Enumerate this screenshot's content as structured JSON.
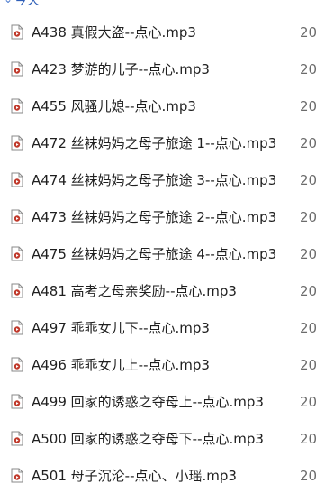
{
  "group_header": {
    "label": "今天"
  },
  "files": [
    {
      "name": "A438 真假大盗--点心.mp3",
      "date": "20",
      "icon": "audio-file-icon"
    },
    {
      "name": "A423 梦游的儿子--点心.mp3",
      "date": "20",
      "icon": "audio-file-icon"
    },
    {
      "name": "A455 风骚儿媳--点心.mp3",
      "date": "20",
      "icon": "audio-file-icon"
    },
    {
      "name": "A472 丝袜妈妈之母子旅途 1--点心.mp3",
      "date": "20",
      "icon": "audio-file-icon"
    },
    {
      "name": "A474 丝袜妈妈之母子旅途 3--点心.mp3",
      "date": "20",
      "icon": "audio-file-icon"
    },
    {
      "name": "A473 丝袜妈妈之母子旅途 2--点心.mp3",
      "date": "20",
      "icon": "audio-file-icon"
    },
    {
      "name": "A475 丝袜妈妈之母子旅途 4--点心.mp3",
      "date": "20",
      "icon": "audio-file-icon"
    },
    {
      "name": "A481 高考之母亲奖励--点心.mp3",
      "date": "20",
      "icon": "audio-file-icon"
    },
    {
      "name": "A497 乖乖女儿下--点心.mp3",
      "date": "20",
      "icon": "audio-file-icon"
    },
    {
      "name": "A496 乖乖女儿上--点心.mp3",
      "date": "20",
      "icon": "audio-file-icon"
    },
    {
      "name": "A499 回家的诱惑之夺母上--点心.mp3",
      "date": "20",
      "icon": "audio-file-icon"
    },
    {
      "name": "A500 回家的诱惑之夺母下--点心.mp3",
      "date": "20",
      "icon": "audio-file-icon"
    },
    {
      "name": "A501 母子沉沦--点心、小瑶.mp3",
      "date": "20",
      "icon": "audio-file-icon"
    }
  ],
  "colors": {
    "icon_outline": "#8a8a8a",
    "icon_accent": "#c0392b",
    "text": "#1f1f1f",
    "date_text": "#6b6b6b",
    "header_link": "#2f5fb8"
  }
}
